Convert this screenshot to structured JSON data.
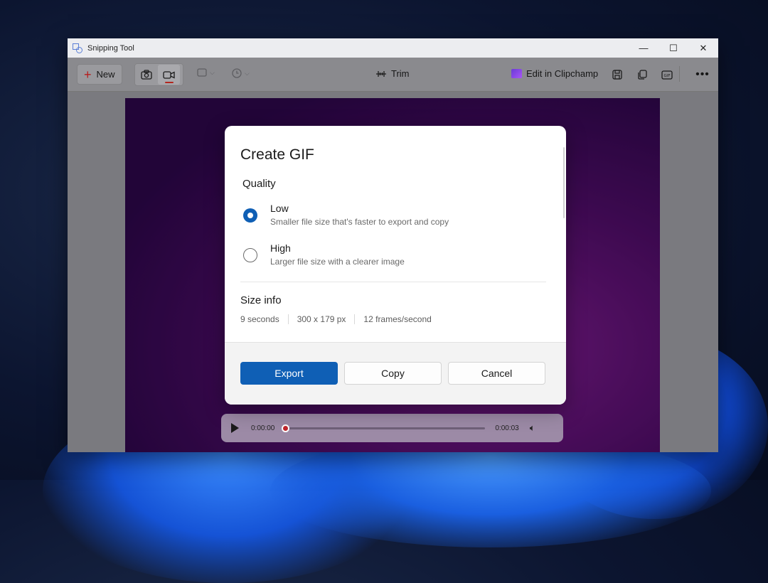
{
  "window": {
    "title": "Snipping Tool",
    "controls": {
      "minimize": "—",
      "maximize": "☐",
      "close": "✕"
    }
  },
  "toolbar": {
    "new_label": "New",
    "trim_label": "Trim",
    "clipchamp_label": "Edit in Clipchamp"
  },
  "player": {
    "current_time": "0:00:00",
    "end_time": "0:00:03",
    "progress": 0
  },
  "dialog": {
    "title": "Create GIF",
    "quality_label": "Quality",
    "options": [
      {
        "title": "Low",
        "description": "Smaller file size that's faster to export and copy",
        "selected": true
      },
      {
        "title": "High",
        "description": "Larger file size with a clearer image",
        "selected": false
      }
    ],
    "size_info_label": "Size info",
    "size_info": [
      "9 seconds",
      "300 x 179 px",
      "12 frames/second"
    ],
    "buttons": {
      "export": "Export",
      "copy": "Copy",
      "cancel": "Cancel"
    }
  },
  "colors": {
    "accent": "#0f5fb5",
    "record_red": "#c0262d"
  }
}
